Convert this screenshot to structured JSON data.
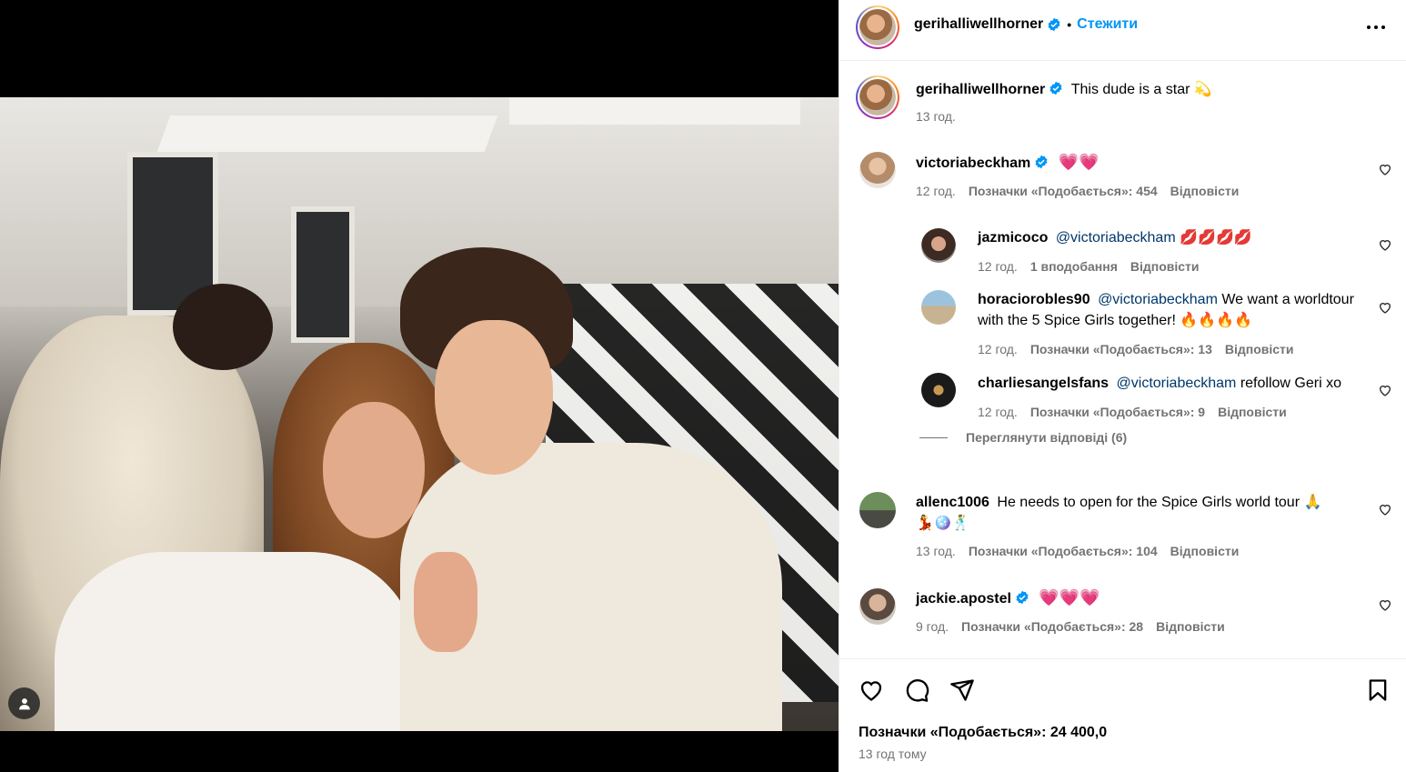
{
  "post": {
    "author": "gerihalliwellhorner",
    "follow_label": "Стежити",
    "caption": "This dude is a star 💫",
    "caption_time": "13 год."
  },
  "comments": [
    {
      "user": "victoriabeckham",
      "verified": true,
      "text": "💗💗",
      "time": "12 год.",
      "likes": "Позначки «Подобається»: 454",
      "reply": "Відповісти"
    },
    {
      "user": "jazmicoco",
      "verified": false,
      "mention": "@victoriabeckham",
      "text": "💋💋💋💋",
      "time": "12 год.",
      "likes": "1 вподобання",
      "reply": "Відповісти"
    },
    {
      "user": "horaciorobles90",
      "verified": false,
      "mention": "@victoriabeckham",
      "text": "We want a worldtour with the 5 Spice Girls together! 🔥🔥🔥🔥",
      "time": "12 год.",
      "likes": "Позначки «Подобається»: 13",
      "reply": "Відповісти"
    },
    {
      "user": "charliesangelsfans",
      "verified": false,
      "mention": "@victoriabeckham",
      "text": "refollow Geri xo",
      "time": "12 год.",
      "likes": "Позначки «Подобається»: 9",
      "reply": "Відповісти"
    },
    {
      "user": "allenc1006",
      "verified": false,
      "text": "He needs to open for the Spice Girls world tour 🙏",
      "text2": "💃🪩🕺",
      "time": "13 год.",
      "likes": "Позначки «Подобається»: 104",
      "reply": "Відповісти"
    },
    {
      "user": "jackie.apostel",
      "verified": true,
      "text": "💗💗💗",
      "time": "9 год.",
      "likes": "Позначки «Подобається»: 28",
      "reply": "Відповісти"
    }
  ],
  "view_replies": "Переглянути відповіді (6)",
  "footer": {
    "likes": "Позначки «Подобається»: 24 400,0",
    "time": "13 год тому"
  },
  "icons": {
    "like": "heart-icon",
    "comment": "comment-icon",
    "share": "share-icon",
    "save": "bookmark-icon",
    "more": "more-icon",
    "verified": "verified-badge-icon",
    "user_tag": "user-tag-icon"
  },
  "colors": {
    "accent": "#0095f6",
    "verified": "#0095f6",
    "mention": "#00376b",
    "muted": "#737373"
  }
}
